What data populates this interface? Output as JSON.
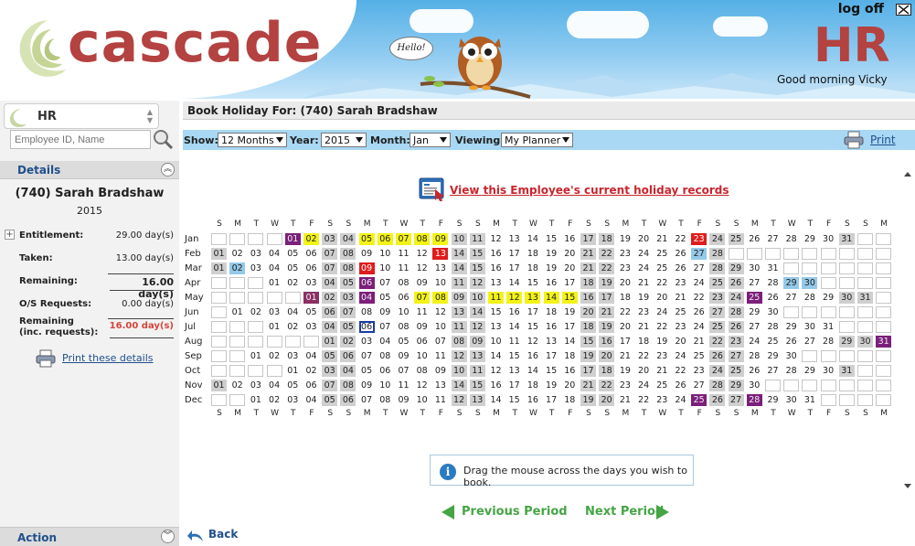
{
  "header": {
    "brand": "cascade",
    "logoff_label": "log off",
    "module_big": "HR",
    "greeting": "Good morning Vicky",
    "bubble_text": "Hello!"
  },
  "sidebar": {
    "module_selected": "HR",
    "search_placeholder": "Employee ID, Name",
    "details_title": "Details",
    "employee_name": "(740) Sarah Bradshaw",
    "year": "2015",
    "rows": [
      {
        "label": "Entitlement:",
        "value": "29.00 day(s)"
      },
      {
        "label": "Taken:",
        "value": "13.00 day(s)"
      },
      {
        "label": "Remaining:",
        "value": "16.00 day(s)"
      },
      {
        "label": "O/S Requests:",
        "value": "0.00 day(s)"
      },
      {
        "label": "Remaining\n(inc. requests):",
        "value": "16.00 day(s)"
      }
    ],
    "print_details_label": "Print these details",
    "action_title": "Action"
  },
  "main": {
    "title": "Book Holiday For: (740) Sarah Bradshaw",
    "filters": {
      "show_label": "Show:",
      "show_value": "12 Months",
      "year_label": "Year:",
      "year_value": "2015",
      "month_label": "Month:",
      "month_value": "Jan",
      "viewing_label": "Viewing:",
      "viewing_value": "My Planner"
    },
    "print_label": "Print",
    "history_link": "View this Employee's current holiday records",
    "info_text": "Drag the mouse across the days you wish to book.",
    "prev_label": "Previous Period",
    "next_label": "Next Period",
    "back_label": "Back"
  },
  "colors": {
    "brand_red": "#b34240",
    "link_blue": "#21508c",
    "filter_bar": "#a8d8f3",
    "weekend": "#cfcfcf",
    "holiday_booked": "#f3f318",
    "bank_holiday": "#7b1f7b",
    "red_flag": "#e01c1c",
    "pending": "#94c9ea",
    "nav_green": "#45a545"
  },
  "planner": {
    "day_headers": [
      "S",
      "M",
      "T",
      "W",
      "T",
      "F",
      "S",
      "S",
      "M",
      "T",
      "W",
      "T",
      "F",
      "S",
      "S",
      "M",
      "T",
      "W",
      "T",
      "F",
      "S",
      "S",
      "M",
      "T",
      "W",
      "T",
      "F",
      "S",
      "S",
      "M",
      "T",
      "W",
      "T",
      "F",
      "S",
      "S",
      "M"
    ],
    "months": [
      {
        "name": "Jan",
        "start": 4,
        "days": 31,
        "marks": {
          "1": "bh",
          "2": "hol",
          "5": "hol",
          "6": "hol",
          "7": "hol",
          "8": "hol",
          "9": "hol",
          "23": "red"
        }
      },
      {
        "name": "Feb",
        "start": 0,
        "days": 28,
        "marks": {
          "13": "red",
          "27": "pend"
        }
      },
      {
        "name": "Mar",
        "start": 0,
        "days": 31,
        "marks": {
          "2": "pend",
          "9": "red"
        }
      },
      {
        "name": "Apr",
        "start": 3,
        "days": 30,
        "marks": {
          "6": "bh",
          "29": "pend",
          "30": "pend"
        }
      },
      {
        "name": "May",
        "start": 5,
        "days": 31,
        "marks": {
          "1": "pur",
          "4": "bh",
          "7": "hol",
          "8": "hol",
          "11": "hol",
          "12": "hol",
          "13": "hol",
          "14": "hol",
          "15": "hol",
          "25": "bh"
        }
      },
      {
        "name": "Jun",
        "start": 1,
        "days": 30,
        "marks": {}
      },
      {
        "name": "Jul",
        "start": 3,
        "days": 31,
        "marks": {
          "6": "today"
        }
      },
      {
        "name": "Aug",
        "start": 6,
        "days": 31,
        "marks": {
          "31": "bh"
        }
      },
      {
        "name": "Sep",
        "start": 2,
        "days": 30,
        "marks": {}
      },
      {
        "name": "Oct",
        "start": 4,
        "days": 31,
        "marks": {}
      },
      {
        "name": "Nov",
        "start": 0,
        "days": 30,
        "marks": {}
      },
      {
        "name": "Dec",
        "start": 2,
        "days": 31,
        "marks": {
          "25": "bh",
          "28": "bh"
        }
      }
    ]
  }
}
